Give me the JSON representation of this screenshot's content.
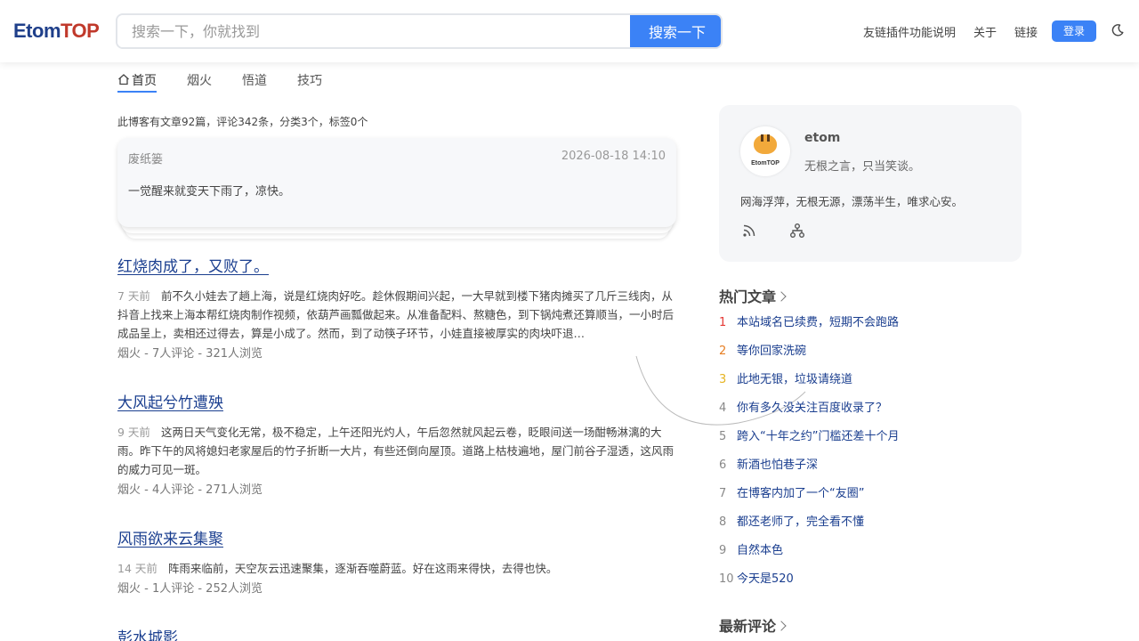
{
  "header": {
    "logo_part1": "Etom",
    "logo_part2": "TOP",
    "search_placeholder": "搜索一下，你就找到",
    "search_button": "搜索一下",
    "nav": [
      "友链插件功能说明",
      "关于",
      "链接"
    ],
    "login": "登录"
  },
  "tabs": [
    "首页",
    "烟火",
    "悟道",
    "技巧"
  ],
  "stats": "此博客有文章92篇，评论342条，分类3个，标签0个",
  "note": {
    "author": "废纸篓",
    "time": "2026-08-18 14:10",
    "text": "一觉醒来就变天下雨了，凉快。"
  },
  "articles": [
    {
      "title": "红烧肉成了，又败了。",
      "age": "7 天前",
      "excerpt": "前不久小娃去了趟上海，说是红烧肉好吃。趁休假期间兴起，一大早就到楼下猪肉摊买了几斤三线肉，从抖音上找来上海本帮红烧肉制作视频，依葫芦画瓢做起来。从准备配料、熬糖色，到下锅炖煮还算顺当，一小时后成品呈上，卖相还过得去，算是小成了。然而，到了动筷子环节，小娃直接被厚实的肉块吓退…",
      "meta": "烟火 - 7人评论 - 321人浏览"
    },
    {
      "title": "大风起兮竹遭殃",
      "age": "9 天前",
      "excerpt": "这两日天气变化无常，极不稳定，上午还阳光灼人，午后忽然就风起云卷，眨眼间送一场酣畅淋漓的大雨。昨下午的风将媳妇老家屋后的竹子折断一大片，有些还倒向屋顶。道路上枯枝遍地，屋门前谷子湿透，这风雨的威力可见一斑。",
      "meta": "烟火 - 4人评论 - 271人浏览"
    },
    {
      "title": "风雨欲来云集聚",
      "age": "14 天前",
      "excerpt": "阵雨来临前，天空灰云迅速聚集，逐渐吞噬蔚蓝。好在这雨来得快，去得也快。",
      "meta": "烟火 - 1人评论 - 252人浏览"
    },
    {
      "title": "彭水城影"
    }
  ],
  "profile": {
    "avatar_text": "EtomTOP",
    "name": "etom",
    "motto": "无根之言，只当笑谈。",
    "desc": "网海浮萍，无根无源，漂荡半生，唯求心安。"
  },
  "hot": {
    "title": "热门文章",
    "rank_colors": [
      "#e53935",
      "#e67e22",
      "#e6b422"
    ],
    "items": [
      {
        "rank": "1",
        "title": "本站域名已续费，短期不会跑路"
      },
      {
        "rank": "2",
        "title": "等你回家洗碗"
      },
      {
        "rank": "3",
        "title": "此地无银，垃圾请绕道"
      },
      {
        "rank": "4",
        "title": "你有多久没关注百度收录了？"
      },
      {
        "rank": "5",
        "title": "跨入“十年之约”门槛还差十个月"
      },
      {
        "rank": "6",
        "title": "新酒也怕巷子深"
      },
      {
        "rank": "7",
        "title": "在博客内加了一个“友圈”"
      },
      {
        "rank": "8",
        "title": "都还老师了，完全看不懂"
      },
      {
        "rank": "9",
        "title": "自然本色"
      },
      {
        "rank": "10",
        "title": "今天是520"
      }
    ]
  },
  "latest_comments_title": "最新评论"
}
